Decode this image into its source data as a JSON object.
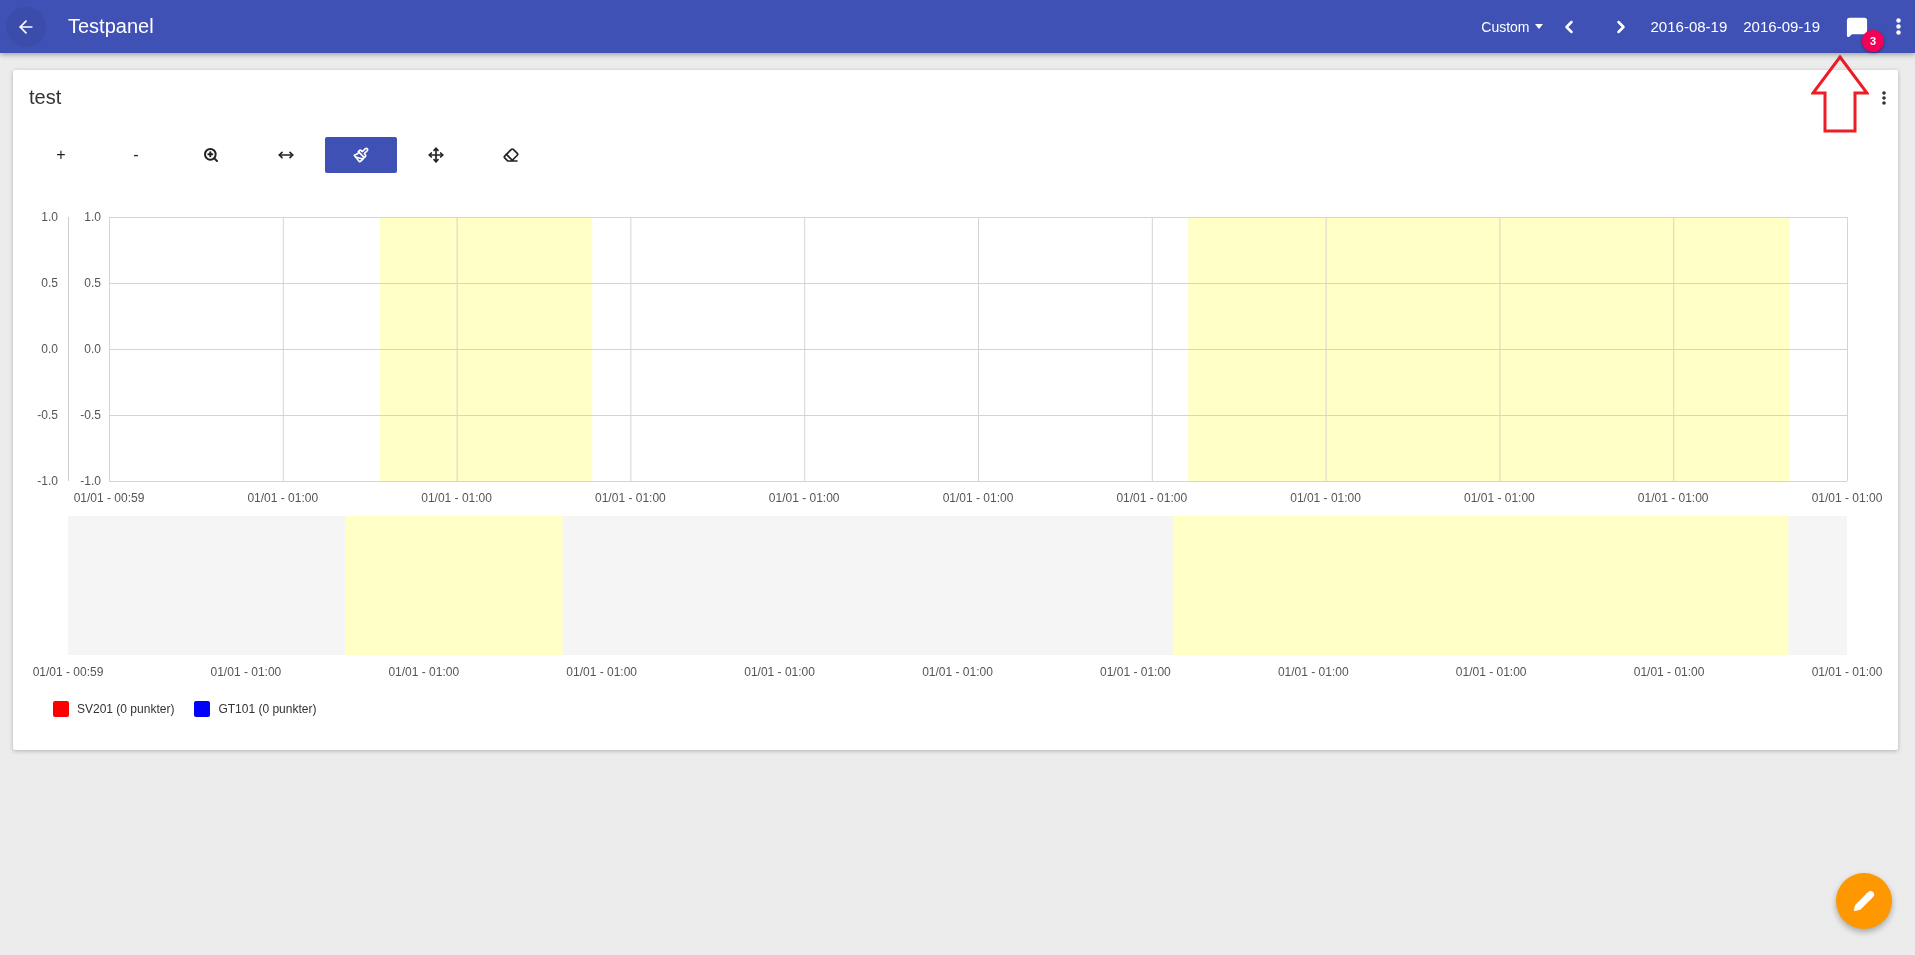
{
  "app_bar": {
    "title": "Testpanel",
    "range_preset": "Custom",
    "start_date": "2016-08-19",
    "end_date": "2016-09-19",
    "notification_count": "3"
  },
  "panel": {
    "title": "test",
    "tools": [
      {
        "kind": "text",
        "label": "+",
        "selected": false
      },
      {
        "kind": "text",
        "label": "-",
        "selected": false
      },
      {
        "kind": "zoom",
        "selected": false
      },
      {
        "kind": "stretch",
        "selected": false
      },
      {
        "kind": "brush",
        "selected": true
      },
      {
        "kind": "move",
        "selected": false
      },
      {
        "kind": "eraser",
        "selected": false
      }
    ],
    "chart": {
      "y_ticks_outer": [
        "1.0",
        "0.5",
        "0.0",
        "-0.5",
        "-1.0"
      ],
      "y_ticks_inner": [
        "1.0",
        "0.5",
        "0.0",
        "-0.5",
        "-1.0"
      ],
      "x_ticks": [
        "01/01 - 00:59",
        "01/01 - 01:00",
        "01/01 - 01:00",
        "01/01 - 01:00",
        "01/01 - 01:00",
        "01/01 - 01:00",
        "01/01 - 01:00",
        "01/01 - 01:00",
        "01/01 - 01:00",
        "01/01 - 01:00",
        "01/01 - 01:00"
      ],
      "overview_x_ticks": [
        "01/01 - 00:59",
        "01/01 - 01:00",
        "01/01 - 01:00",
        "01/01 - 01:00",
        "01/01 - 01:00",
        "01/01 - 01:00",
        "01/01 - 01:00",
        "01/01 - 01:00",
        "01/01 - 01:00",
        "01/01 - 01:00",
        "01/01 - 01:00"
      ]
    },
    "legend": [
      {
        "label": "SV201 (0 punkter)",
        "color": "#ff0000"
      },
      {
        "label": "GT101 (0 punkter)",
        "color": "#0000ff"
      }
    ]
  }
}
